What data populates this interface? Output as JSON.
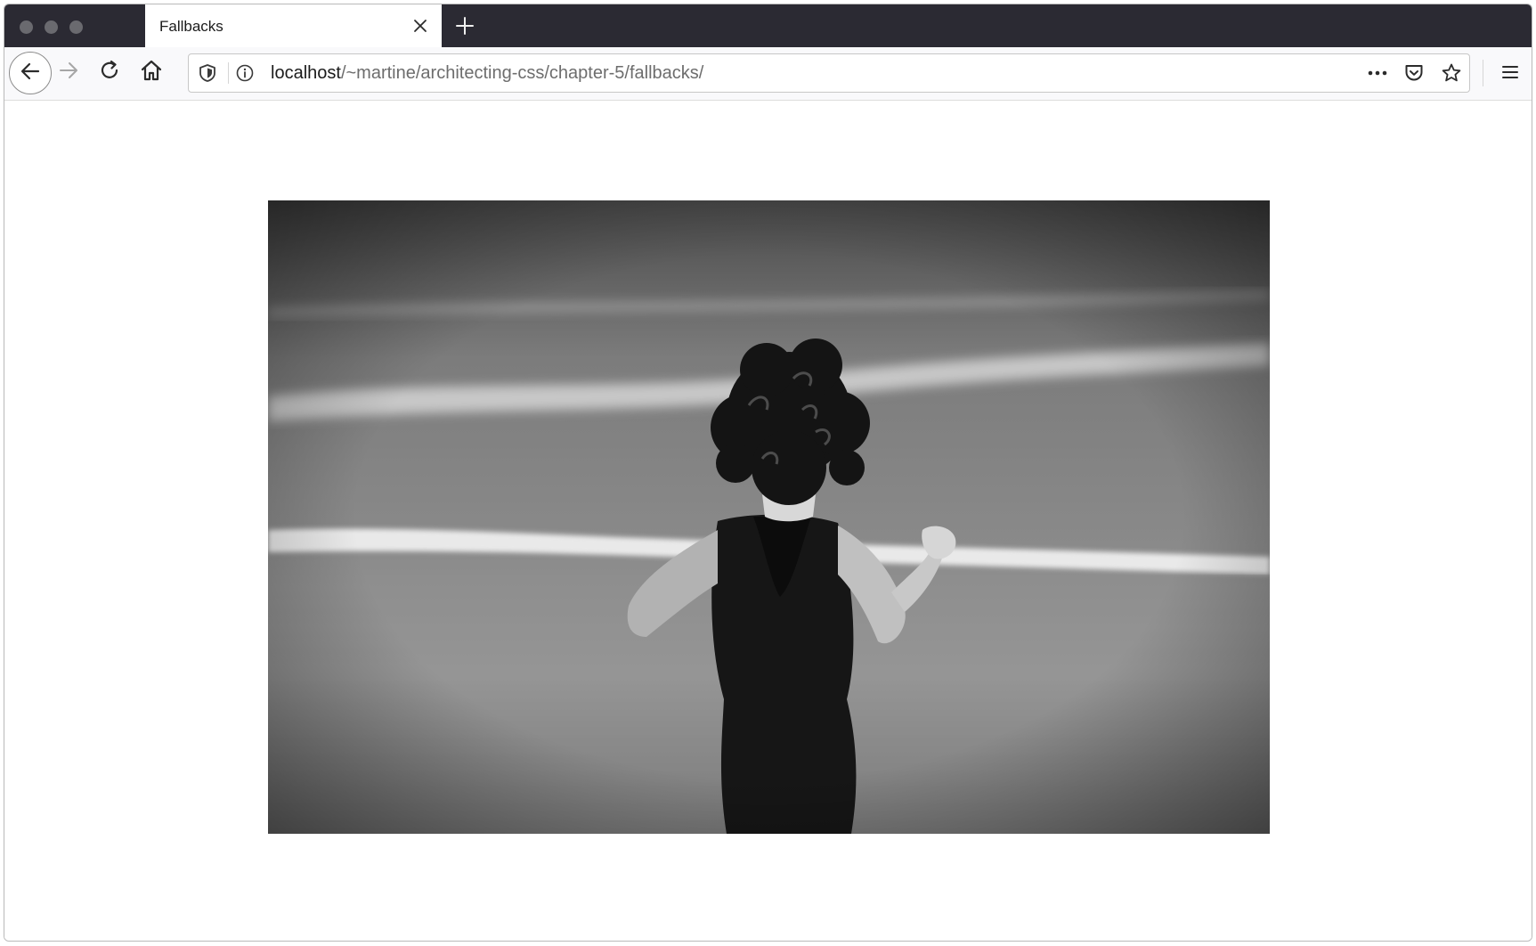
{
  "browser": {
    "tab": {
      "title": "Fallbacks"
    },
    "url": {
      "host": "localhost",
      "path": "/~martine/architecting-css/chapter-5/fallbacks/"
    },
    "icons": {
      "window_controls": [
        "window-close-dot",
        "window-minimize-dot",
        "window-zoom-dot"
      ],
      "tab_close": "close-icon",
      "new_tab": "plus-icon",
      "back": "arrow-left-icon",
      "forward": "arrow-right-icon",
      "reload": "reload-icon",
      "home": "home-icon",
      "tracking": "shield-icon",
      "site_info": "info-icon",
      "page_actions": "more-horizontal-icon",
      "pocket": "pocket-icon",
      "bookmark": "star-icon",
      "menu": "hamburger-menu-icon"
    }
  },
  "page": {
    "image": {
      "description_visible": false,
      "style": "grayscale"
    }
  },
  "colors": {
    "tab_strip": "#2b2a33",
    "toolbar": "#f9f9fb",
    "page_background": "#ffffff"
  }
}
